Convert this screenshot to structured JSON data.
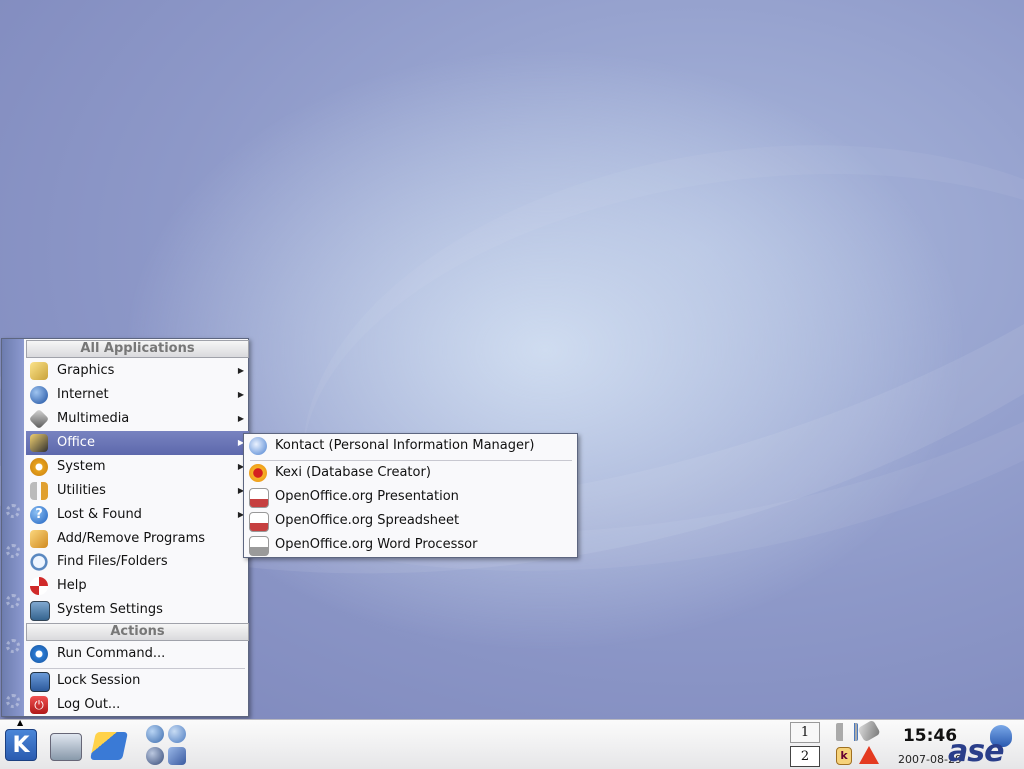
{
  "kmenu": {
    "header_apps": "All Applications",
    "items": [
      {
        "label": "Graphics",
        "submenu": true,
        "icon": "graphics-icon",
        "color": "#e8c040"
      },
      {
        "label": "Internet",
        "submenu": true,
        "icon": "globe-icon",
        "color": "#2a60b0"
      },
      {
        "label": "Multimedia",
        "submenu": true,
        "icon": "multimedia-icon",
        "color": "#606060"
      },
      {
        "label": "Office",
        "submenu": true,
        "icon": "office-icon",
        "color": "#303030",
        "active": true
      },
      {
        "label": "System",
        "submenu": true,
        "icon": "system-gear-icon",
        "color": "#e0a020"
      },
      {
        "label": "Utilities",
        "submenu": true,
        "icon": "utilities-icon",
        "color": "#8a8a8a"
      },
      {
        "label": "Lost & Found",
        "submenu": true,
        "icon": "help-question-icon",
        "color": "#3a80d0"
      },
      {
        "label": "Add/Remove Programs",
        "submenu": false,
        "icon": "package-icon",
        "color": "#e0a040"
      },
      {
        "label": "Find Files/Folders",
        "submenu": false,
        "icon": "find-magnifier-icon",
        "color": "#6090c0"
      },
      {
        "label": "Help",
        "submenu": false,
        "icon": "help-lifebuoy-icon",
        "color": "#d03030"
      },
      {
        "label": "System Settings",
        "submenu": false,
        "icon": "settings-monitor-icon",
        "color": "#5080a0"
      }
    ],
    "header_actions": "Actions",
    "actions": [
      {
        "label": "Run Command...",
        "icon": "run-gear-icon",
        "color": "#2a78d0"
      },
      {
        "label": "Lock Session",
        "icon": "lock-icon",
        "color": "#3a6fb8"
      },
      {
        "label": "Log Out...",
        "icon": "logout-power-icon",
        "color": "#d02828"
      }
    ]
  },
  "office_submenu": {
    "items": [
      {
        "label": "Kontact (Personal Information Manager)",
        "icon": "kontact-icon",
        "color": "#4a80d0"
      },
      {
        "label": "Kexi (Database Creator)",
        "icon": "kexi-icon",
        "color": "#f0a020"
      },
      {
        "label": "OpenOffice.org Presentation",
        "icon": "presentation-icon",
        "color": "#c04040"
      },
      {
        "label": "OpenOffice.org Spreadsheet",
        "icon": "spreadsheet-icon",
        "color": "#c04040"
      },
      {
        "label": "OpenOffice.org Word Processor",
        "icon": "word-processor-icon",
        "color": "#909090"
      }
    ]
  },
  "taskbar": {
    "k_label": "K",
    "pager": [
      "1",
      "2"
    ],
    "clock": "15:46",
    "date": "2007-08-29",
    "logo": "ase"
  }
}
